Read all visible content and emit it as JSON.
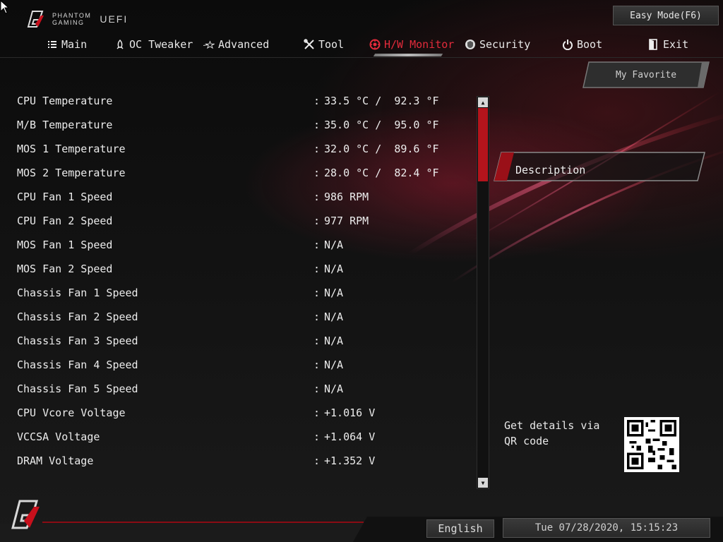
{
  "header": {
    "brand_line1": "PHANTOM",
    "brand_line2": "GAMING",
    "brand_suffix": "UEFI",
    "easy_mode_label": "Easy Mode(F6)"
  },
  "nav": {
    "tabs": [
      {
        "label": "Main",
        "icon": "list-icon"
      },
      {
        "label": "OC Tweaker",
        "icon": "rocket-icon"
      },
      {
        "label": "Advanced",
        "icon": "star-icon"
      },
      {
        "label": "Tool",
        "icon": "tools-icon"
      },
      {
        "label": "H/W Monitor",
        "icon": "gauge-icon",
        "active": true
      },
      {
        "label": "Security",
        "icon": "shield-icon"
      },
      {
        "label": "Boot",
        "icon": "power-icon"
      },
      {
        "label": "Exit",
        "icon": "exit-icon"
      }
    ],
    "accent_color": "#e32b3b"
  },
  "monitor": {
    "rows": [
      {
        "label": "CPU Temperature",
        "value": "33.5 °C /  92.3 °F"
      },
      {
        "label": "M/B Temperature",
        "value": "35.0 °C /  95.0 °F"
      },
      {
        "label": "MOS 1 Temperature",
        "value": "32.0 °C /  89.6 °F"
      },
      {
        "label": "MOS 2 Temperature",
        "value": "28.0 °C /  82.4 °F"
      },
      {
        "label": "CPU Fan 1 Speed",
        "value": "986 RPM"
      },
      {
        "label": "CPU Fan 2 Speed",
        "value": "977 RPM"
      },
      {
        "label": "MOS Fan 1 Speed",
        "value": "N/A"
      },
      {
        "label": "MOS Fan 2 Speed",
        "value": "N/A"
      },
      {
        "label": "Chassis Fan 1 Speed",
        "value": "N/A"
      },
      {
        "label": "Chassis Fan 2 Speed",
        "value": "N/A"
      },
      {
        "label": "Chassis Fan 3 Speed",
        "value": "N/A"
      },
      {
        "label": "Chassis Fan 4 Speed",
        "value": "N/A"
      },
      {
        "label": "Chassis Fan 5 Speed",
        "value": "N/A"
      },
      {
        "label": "CPU Vcore Voltage",
        "value": "+1.016 V"
      },
      {
        "label": "VCCSA Voltage",
        "value": "+1.064 V"
      },
      {
        "label": "DRAM Voltage",
        "value": "+1.352 V"
      }
    ],
    "separator": ":"
  },
  "sidebar": {
    "favorite_label": "My Favorite",
    "description_label": "Description",
    "qr_text": "Get details via QR code"
  },
  "footer": {
    "language_label": "English",
    "datetime": "Tue 07/28/2020, 15:15:23"
  }
}
